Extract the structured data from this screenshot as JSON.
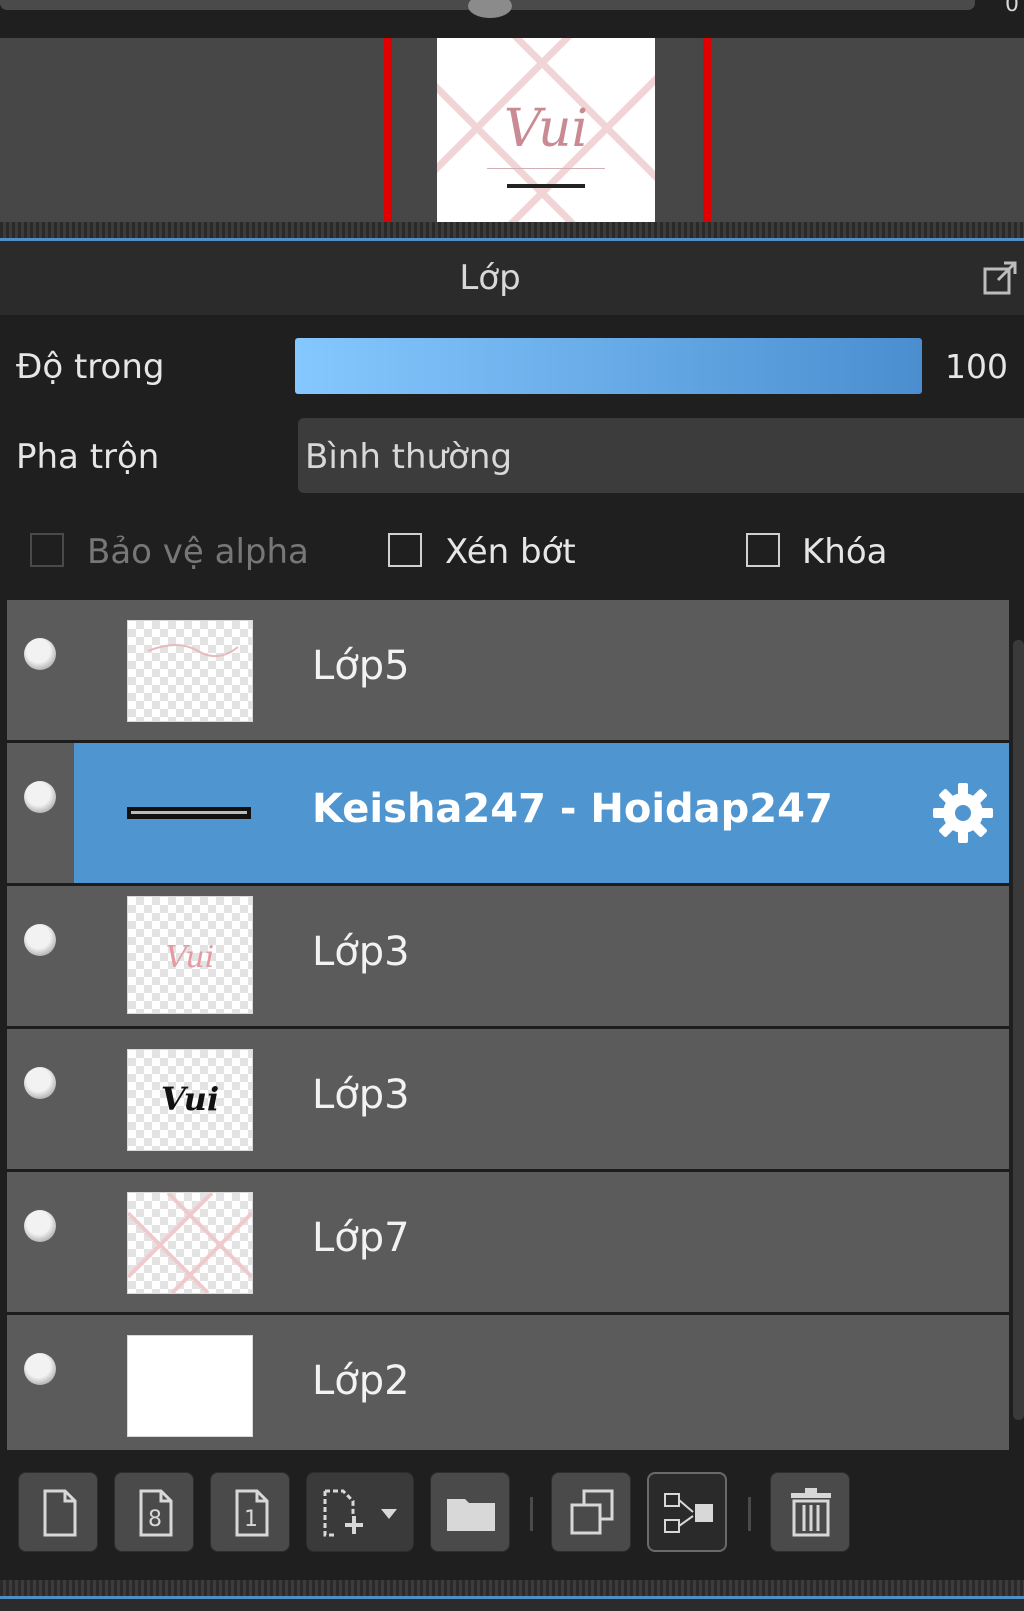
{
  "top_slider": {
    "value_partial": "0"
  },
  "navigator": {
    "preview_text": "Vui"
  },
  "panel": {
    "title": "Lớp"
  },
  "properties": {
    "opacity_label": "Độ trong",
    "opacity_value": "100",
    "opacity_level": 1.0,
    "blend_label": "Pha trộn",
    "blend_value": "Bình thường"
  },
  "checkboxes": {
    "alpha_label": "Bảo vệ alpha",
    "alpha_checked": false,
    "alpha_enabled": false,
    "clip_label": "Xén bớt",
    "clip_checked": false,
    "lock_label": "Khóa",
    "lock_checked": false
  },
  "layers": [
    {
      "name": "Lớp5",
      "thumbnail": "transparent-sketch",
      "selected": false
    },
    {
      "name": "Keisha247 - Hoidap247",
      "thumbnail": "text-strip",
      "selected": true
    },
    {
      "name": "Lớp3",
      "thumbnail": "pink-vui",
      "selected": false
    },
    {
      "name": "Lớp3",
      "thumbnail": "black-vui",
      "selected": false
    },
    {
      "name": "Lớp7",
      "thumbnail": "pink-cross",
      "selected": false
    },
    {
      "name": "Lớp2",
      "thumbnail": "white",
      "selected": false
    }
  ],
  "toolbar": {
    "buttons": [
      {
        "name": "new-layer-icon"
      },
      {
        "name": "new-8bit-layer-icon",
        "glyph": "8"
      },
      {
        "name": "new-1bit-layer-icon",
        "glyph": "1"
      },
      {
        "name": "add-layer-menu-icon"
      },
      {
        "name": "folder-icon"
      },
      {
        "name": "duplicate-layer-icon"
      },
      {
        "name": "merge-down-icon"
      },
      {
        "name": "delete-layer-icon"
      }
    ]
  },
  "colors": {
    "accent": "#4f95cf",
    "frame_red": "#e00000",
    "panel_bg": "#1f1f1f",
    "row_bg": "#5b5b5b"
  }
}
